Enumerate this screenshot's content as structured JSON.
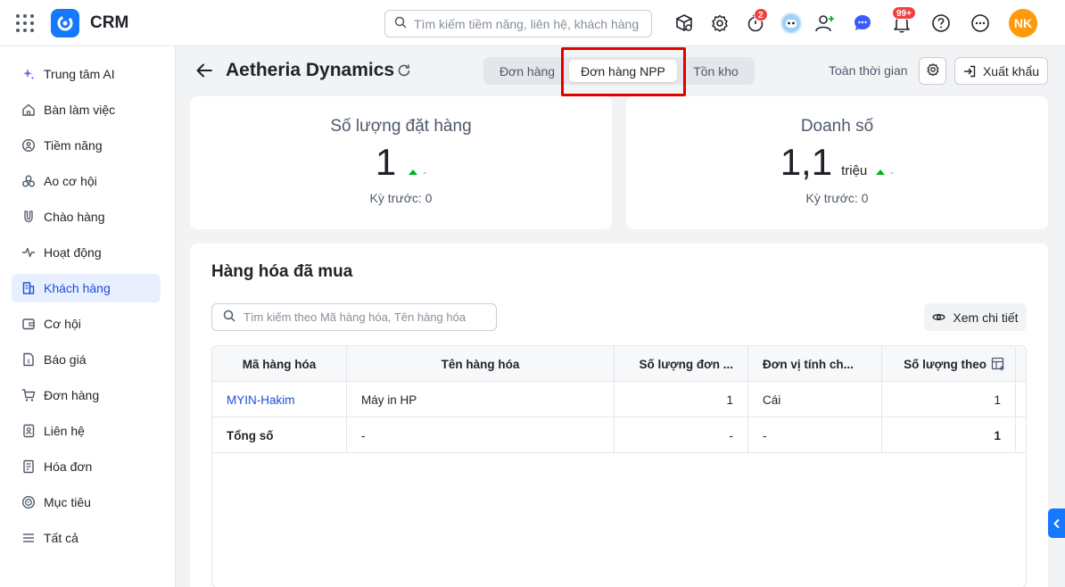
{
  "app": {
    "name": "CRM"
  },
  "search": {
    "placeholder": "Tìm kiếm tiềm năng, liên hệ, khách hàng"
  },
  "topbar": {
    "timer_badge": "2",
    "notification_badge": "99+",
    "avatar_initials": "NK"
  },
  "sidebar": {
    "items": [
      {
        "label": "Trung tâm AI",
        "icon": "sparkle-icon"
      },
      {
        "label": "Bàn làm việc",
        "icon": "home-icon"
      },
      {
        "label": "Tiềm năng",
        "icon": "target-person-icon"
      },
      {
        "label": "Ao cơ hội",
        "icon": "pool-icon"
      },
      {
        "label": "Chào hàng",
        "icon": "magnet-icon"
      },
      {
        "label": "Hoạt động",
        "icon": "activity-icon"
      },
      {
        "label": "Khách hàng",
        "icon": "building-icon"
      },
      {
        "label": "Cơ hội",
        "icon": "wallet-icon"
      },
      {
        "label": "Báo giá",
        "icon": "quote-doc-icon"
      },
      {
        "label": "Đơn hàng",
        "icon": "cart-icon"
      },
      {
        "label": "Liên hệ",
        "icon": "contact-icon"
      },
      {
        "label": "Hóa đơn",
        "icon": "invoice-icon"
      },
      {
        "label": "Mục tiêu",
        "icon": "goal-icon"
      },
      {
        "label": "Tất cả",
        "icon": "menu-icon"
      }
    ],
    "active_index": 6
  },
  "header": {
    "title": "Aetheria Dynamics",
    "tabs": [
      "Đơn hàng",
      "Đơn hàng NPP",
      "Tồn kho"
    ],
    "active_tab": 1,
    "time_filter": "Toàn thời gian",
    "export_label": "Xuất khẩu"
  },
  "stats": [
    {
      "title": "Số lượng đặt hàng",
      "value": "1",
      "unit": "",
      "trend": "-",
      "previous": "Kỳ trước: 0"
    },
    {
      "title": "Doanh số",
      "value": "1,1",
      "unit": "triệu",
      "trend": "-",
      "previous": "Kỳ trước: 0"
    }
  ],
  "products": {
    "title": "Hàng hóa đã mua",
    "search_placeholder": "Tìm kiếm theo Mã hàng hóa, Tên hàng hóa",
    "detail_button": "Xem chi tiết",
    "columns": [
      "Mã hàng hóa",
      "Tên hàng hóa",
      "Số lượng đơn ...",
      "Đơn vị tính ch...",
      "Số lượng theo"
    ],
    "rows": [
      {
        "code": "MYIN-Hakim",
        "name": "Máy in HP",
        "qty": "1",
        "unit": "Cái",
        "qty_unit": "1"
      }
    ],
    "total": {
      "label": "Tổng số",
      "name": "-",
      "qty": "-",
      "unit": "-",
      "qty_unit": "1"
    }
  },
  "colors": {
    "accent": "#1677ff",
    "active_nav_bg": "#e8efff",
    "highlight": "#e10000",
    "trend_up": "#00b42a",
    "avatar": "#ff9a0d"
  }
}
